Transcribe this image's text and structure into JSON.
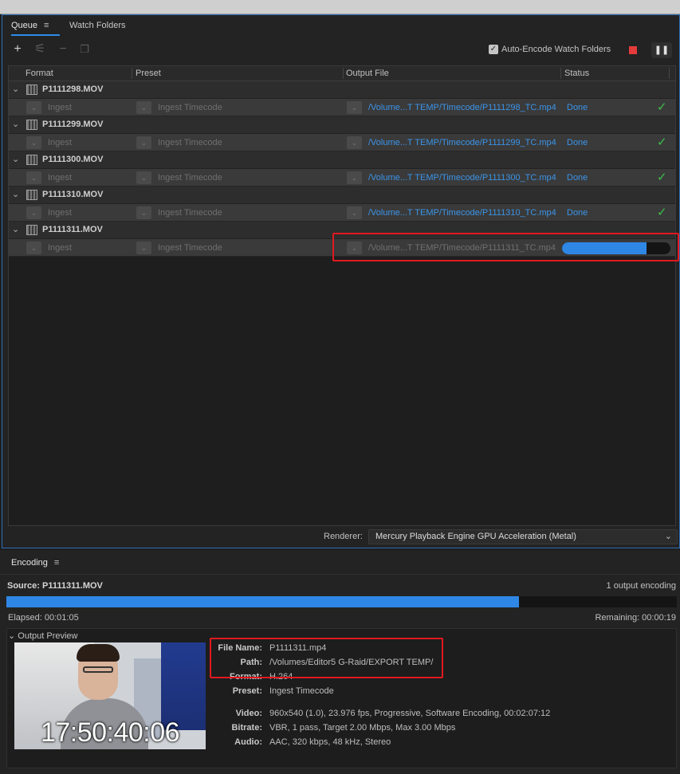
{
  "queue": {
    "tabs": [
      {
        "label": "Queue"
      },
      {
        "label": "Watch Folders"
      }
    ],
    "menu_glyph": "≡",
    "toolbar": {
      "add": "+",
      "settings": "⚟",
      "remove": "−",
      "duplicate": "❐",
      "auto_encode_label": "Auto-Encode Watch Folders",
      "auto_encode_checked": "✓",
      "pause": "❚❚"
    },
    "columns": [
      "Format",
      "Preset",
      "Output File",
      "Status"
    ],
    "groups": [
      {
        "name": "P1111298.MOV",
        "format": "Ingest",
        "preset": "Ingest Timecode",
        "output": "/Volume...T TEMP/Timecode/P1111298_TC.mp4",
        "status": "Done",
        "status_icon": "✓"
      },
      {
        "name": "P1111299.MOV",
        "format": "Ingest",
        "preset": "Ingest Timecode",
        "output": "/Volume...T TEMP/Timecode/P1111299_TC.mp4",
        "status": "Done",
        "status_icon": "✓"
      },
      {
        "name": "P1111300.MOV",
        "format": "Ingest",
        "preset": "Ingest Timecode",
        "output": "/Volume...T TEMP/Timecode/P1111300_TC.mp4",
        "status": "Done",
        "status_icon": "✓"
      },
      {
        "name": "P1111310.MOV",
        "format": "Ingest",
        "preset": "Ingest Timecode",
        "output": "/Volume...T TEMP/Timecode/P1111310_TC.mp4",
        "status": "Done",
        "status_icon": "✓"
      },
      {
        "name": "P1111311.MOV",
        "format": "Ingest",
        "preset": "Ingest Timecode",
        "output": "/Volume...T TEMP/Timecode/P1111311_TC.mp4",
        "status": "",
        "progress": 0.78
      }
    ],
    "renderer_label": "Renderer:",
    "renderer_value": "Mercury Playback Engine GPU Acceleration (Metal)"
  },
  "encoding": {
    "tab_label": "Encoding",
    "menu_glyph": "≡",
    "source_label": "Source:",
    "source_value": "P1111311.MOV",
    "output_count": "1 output encoding",
    "progress": 0.765,
    "elapsed": "Elapsed: 00:01:05",
    "remaining": "Remaining: 00:00:19",
    "preview_label": "Output Preview",
    "timecode": "17:50:40:06",
    "meta": [
      {
        "k": "File Name:",
        "v": "P1111311.mp4"
      },
      {
        "k": "Path:",
        "v": "/Volumes/Editor5 G-Raid/EXPORT TEMP/"
      },
      {
        "k": "Format:",
        "v": "H.264"
      },
      {
        "k": "Preset:",
        "v": "Ingest Timecode"
      },
      {
        "k": "Video:",
        "v": "960x540 (1.0), 23.976 fps, Progressive, Software Encoding, 00:02:07:12"
      },
      {
        "k": "Bitrate:",
        "v": "VBR, 1 pass, Target 2.00 Mbps, Max 3.00 Mbps"
      },
      {
        "k": "Audio:",
        "v": "AAC, 320 kbps, 48 kHz, Stereo"
      }
    ]
  },
  "colors": {
    "accent": "#2f87e5",
    "link": "#3b94e8",
    "done_check": "#3cbf4a",
    "highlight": "#e0191f",
    "stop": "#e43b3b"
  }
}
